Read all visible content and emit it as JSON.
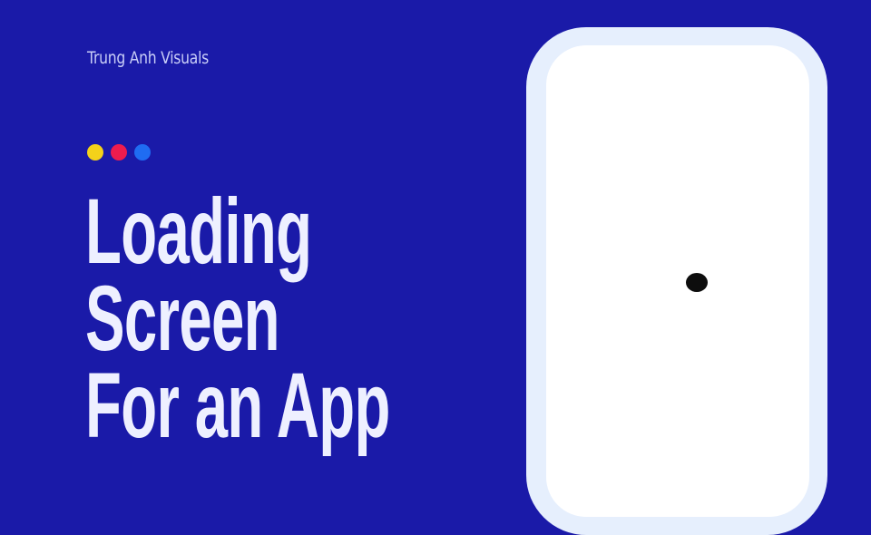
{
  "brand": {
    "name": "Trung Anh Visuals"
  },
  "headline": {
    "lines": [
      "Loading",
      "Screen",
      "For an App"
    ]
  },
  "indicator_dots": [
    {
      "color": "#f4d21a",
      "icon": "yellow-dot"
    },
    {
      "color": "#ee1c4e",
      "icon": "red-dot"
    },
    {
      "color": "#1f6cf2",
      "icon": "blue-dot"
    }
  ],
  "colors": {
    "background": "#1a1aa8",
    "brand_text": "#c8cdf7",
    "headline_text": "#eef0ff",
    "phone_frame": "#e6effd",
    "phone_screen": "#ffffff",
    "loader": "#0d0d0d"
  }
}
